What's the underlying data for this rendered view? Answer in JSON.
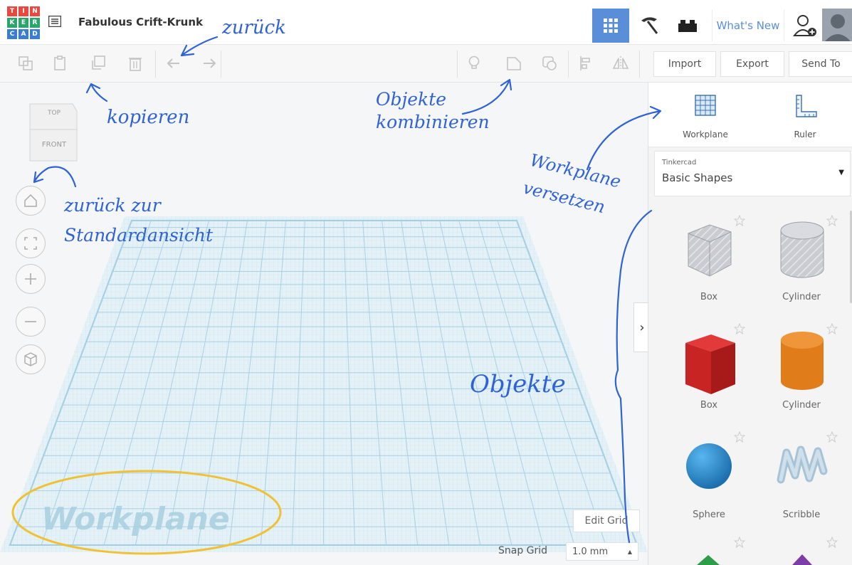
{
  "app": {
    "logo_letters": [
      "T",
      "I",
      "N",
      "K",
      "E",
      "R",
      "C",
      "A",
      "D"
    ],
    "logo_colors": [
      "#e8483f",
      "#e8483f",
      "#e8483f",
      "#2aa56b",
      "#2aa56b",
      "#2aa56b",
      "#3b7ecf",
      "#3b7ecf",
      "#3b7ecf"
    ],
    "design_title": "Fabulous Crift-Krunk",
    "whats_new": "What's New",
    "accent": "#5a8ed8"
  },
  "toolbar": {
    "import": "Import",
    "export": "Export",
    "send_to": "Send To"
  },
  "viewcube": {
    "top": "TOP",
    "front": "FRONT"
  },
  "panel": {
    "workplane_label": "Workplane",
    "ruler_label": "Ruler",
    "library_source": "Tinkercad",
    "library_name": "Basic Shapes",
    "shapes": [
      "Box",
      "Cylinder",
      "Box",
      "Cylinder",
      "Sphere",
      "Scribble"
    ]
  },
  "viewport": {
    "edit_grid": "Edit Grid",
    "snap_grid_label": "Snap Grid",
    "snap_grid_value": "1.0 mm",
    "workplane_watermark": "Workplane"
  },
  "annotations": {
    "undo": "zurück",
    "copy": "kopieren",
    "combine": "Objekte kombinieren",
    "home": "zurück zur Standardansicht",
    "workplane_move": "Workplane versetzen",
    "objects": "Objekte"
  }
}
